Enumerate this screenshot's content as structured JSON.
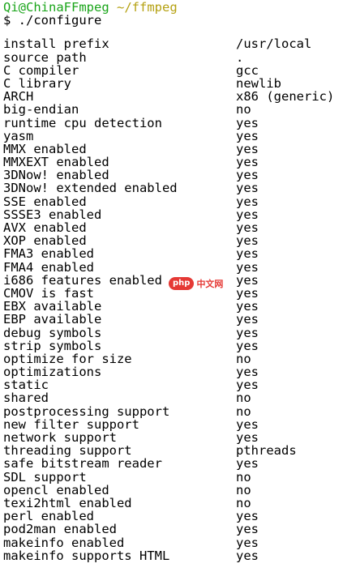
{
  "prompt": {
    "user_host": "Qi@ChinaFFmpeg",
    "path": "~/ffmpeg",
    "command": "$ ./configure"
  },
  "config": [
    {
      "key": "install prefix",
      "value": "/usr/local"
    },
    {
      "key": "source path",
      "value": "."
    },
    {
      "key": "C compiler",
      "value": "gcc"
    },
    {
      "key": "C library",
      "value": "newlib"
    },
    {
      "key": "ARCH",
      "value": "x86 (generic)"
    },
    {
      "key": "big-endian",
      "value": "no"
    },
    {
      "key": "runtime cpu detection",
      "value": "yes"
    },
    {
      "key": "yasm",
      "value": "yes"
    },
    {
      "key": "MMX enabled",
      "value": "yes"
    },
    {
      "key": "MMXEXT enabled",
      "value": "yes"
    },
    {
      "key": "3DNow! enabled",
      "value": "yes"
    },
    {
      "key": "3DNow! extended enabled",
      "value": "yes"
    },
    {
      "key": "SSE enabled",
      "value": "yes"
    },
    {
      "key": "SSSE3 enabled",
      "value": "yes"
    },
    {
      "key": "AVX enabled",
      "value": "yes"
    },
    {
      "key": "XOP enabled",
      "value": "yes"
    },
    {
      "key": "FMA3 enabled",
      "value": "yes"
    },
    {
      "key": "FMA4 enabled",
      "value": "yes"
    },
    {
      "key": "i686 features enabled",
      "value": "yes"
    },
    {
      "key": "CMOV is fast",
      "value": "yes"
    },
    {
      "key": "EBX available",
      "value": "yes"
    },
    {
      "key": "EBP available",
      "value": "yes"
    },
    {
      "key": "debug symbols",
      "value": "yes"
    },
    {
      "key": "strip symbols",
      "value": "yes"
    },
    {
      "key": "optimize for size",
      "value": "no"
    },
    {
      "key": "optimizations",
      "value": "yes"
    },
    {
      "key": "static",
      "value": "yes"
    },
    {
      "key": "shared",
      "value": "no"
    },
    {
      "key": "postprocessing support",
      "value": "no"
    },
    {
      "key": "new filter support",
      "value": "yes"
    },
    {
      "key": "network support",
      "value": "yes"
    },
    {
      "key": "threading support",
      "value": "pthreads"
    },
    {
      "key": "safe bitstream reader",
      "value": "yes"
    },
    {
      "key": "SDL support",
      "value": "no"
    },
    {
      "key": "opencl enabled",
      "value": "no"
    },
    {
      "key": "texi2html enabled",
      "value": "no"
    },
    {
      "key": "perl enabled",
      "value": "yes"
    },
    {
      "key": "pod2man enabled",
      "value": "yes"
    },
    {
      "key": "makeinfo enabled",
      "value": "yes"
    },
    {
      "key": "makeinfo supports HTML",
      "value": "yes"
    }
  ],
  "watermark": {
    "badge": "php",
    "text": "中文网"
  },
  "colors": {
    "prompt_user": "#1aa51a",
    "prompt_path": "#b5a112",
    "watermark": "#e53935",
    "background": "#ffffff",
    "text": "#000000"
  }
}
